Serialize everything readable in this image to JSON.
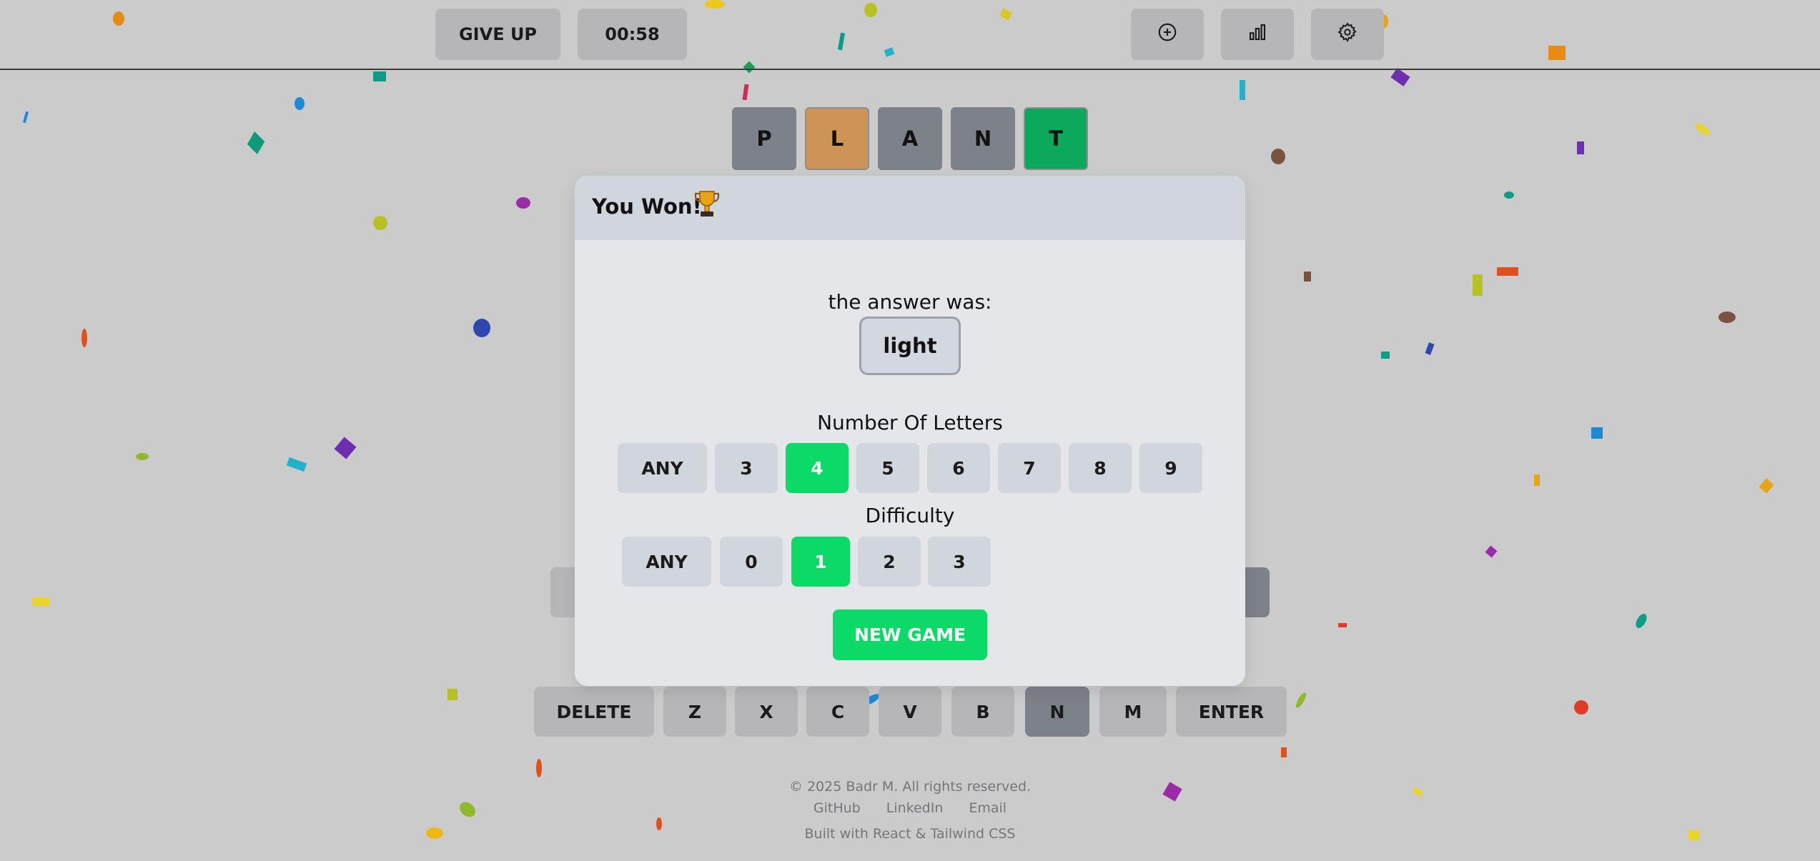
{
  "header": {
    "give_up_label": "GIVE UP",
    "timer": "00:58",
    "icons": [
      "add-circle-icon",
      "bar-chart-icon",
      "gear-icon"
    ]
  },
  "board": {
    "tiles": [
      {
        "letter": "P",
        "state": "absent",
        "color": "#7d8189"
      },
      {
        "letter": "L",
        "state": "present",
        "color": "#cd9455"
      },
      {
        "letter": "A",
        "state": "absent",
        "color": "#7d8189"
      },
      {
        "letter": "N",
        "state": "absent",
        "color": "#7d8189"
      },
      {
        "letter": "T",
        "state": "correct",
        "color": "#0ca95c"
      }
    ]
  },
  "modal": {
    "title": "You Won!",
    "trophy_icon": "trophy-icon",
    "answer_label": "the answer was:",
    "answer_word": "light",
    "letters_label": "Number Of Letters",
    "letters_options": [
      "ANY",
      "3",
      "4",
      "5",
      "6",
      "7",
      "8",
      "9"
    ],
    "letters_selected": "4",
    "difficulty_label": "Difficulty",
    "difficulty_options": [
      "ANY",
      "0",
      "1",
      "2",
      "3"
    ],
    "difficulty_selected": "1",
    "new_game_label": "NEW GAME"
  },
  "keyboard": {
    "bottom_row": [
      "DELETE",
      "Z",
      "X",
      "C",
      "V",
      "B",
      "N",
      "M",
      "ENTER"
    ],
    "absent_keys": [
      "N"
    ]
  },
  "footer": {
    "copyright": "© 2025 Badr M. All rights reserved.",
    "links": [
      "GitHub",
      "LinkedIn",
      "Email"
    ],
    "built_with": "Built with React & Tailwind CSS"
  },
  "colors": {
    "background": "#cbcbcb",
    "accent_green": "#0bda67",
    "correct": "#0ca95c",
    "present": "#cd9455",
    "absent": "#7d8189"
  }
}
